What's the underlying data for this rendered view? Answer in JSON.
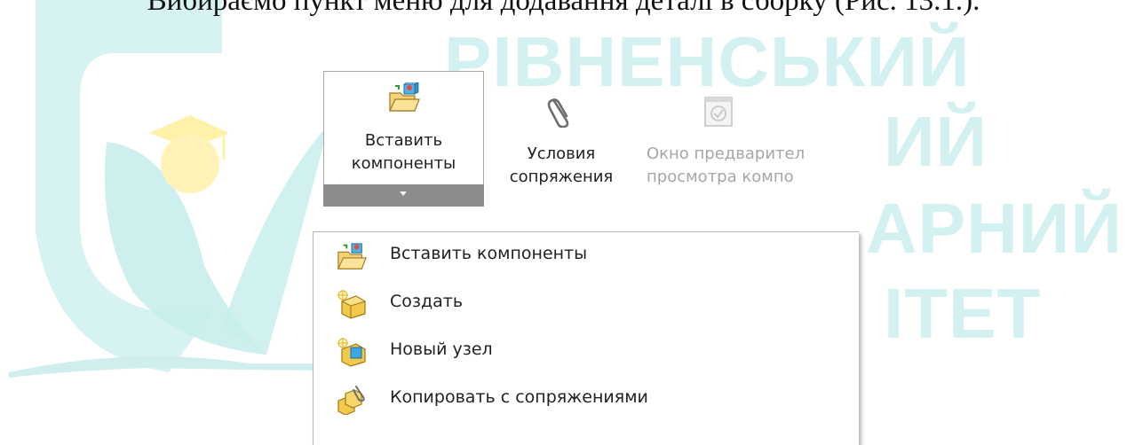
{
  "caption": "Вибираємо пункт меню для додавання деталі в сборку (Рис. 13.1.).",
  "watermark": {
    "line1": "РІВНЕНСЬКИЙ",
    "line2": "ИЙ",
    "line3": "АРНИЙ",
    "line4": "ІТЕТ"
  },
  "ribbon": {
    "insert_components": {
      "line1": "Вставить",
      "line2": "компоненты"
    },
    "mate_conditions": {
      "line1": "Условия",
      "line2": "сопряжения"
    },
    "preview_window": {
      "line1": "Окно предварител",
      "line2": "просмотра компо"
    }
  },
  "menu": {
    "items": [
      {
        "label": "Вставить компоненты",
        "icon": "insert-component-icon"
      },
      {
        "label": "Создать",
        "icon": "new-part-icon"
      },
      {
        "label": "Новый узел",
        "icon": "new-assembly-icon"
      },
      {
        "label": "Копировать с сопряжениями",
        "icon": "copy-with-mates-icon"
      }
    ]
  },
  "colors": {
    "watermark": "#d3f1f1",
    "logo_teal": "#cdeeed",
    "logo_yellow": "#fff3b0",
    "dropdown_bar": "#8c8c8c"
  }
}
